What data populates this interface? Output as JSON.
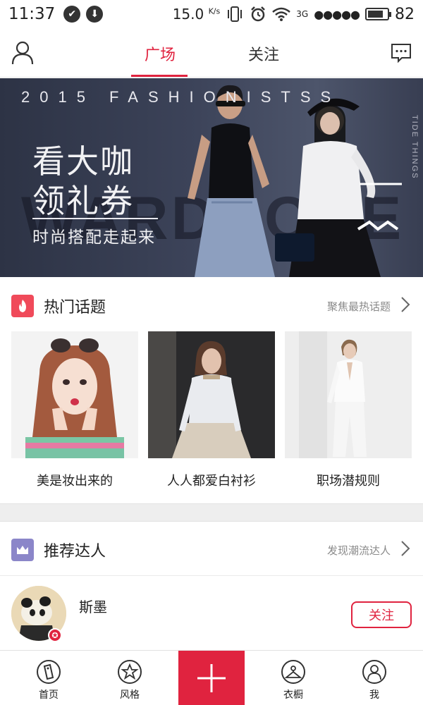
{
  "status_bar": {
    "time": "11:37",
    "net_speed": "15.0",
    "net_unit": "K/s",
    "network": "3G",
    "battery": "82",
    "battery_level": 0.82
  },
  "top_nav": {
    "tabs": [
      {
        "label": "广场",
        "active": true
      },
      {
        "label": "关注",
        "active": false
      }
    ]
  },
  "banner": {
    "header": "2015 FASHIONISTSS",
    "bg_word": "WARDROBE",
    "side_text": "TIDE THINGS",
    "line1": "看大咖",
    "line2": "领礼券",
    "subtitle": "时尚搭配走起来"
  },
  "hot_topics": {
    "title": "热门话题",
    "more": "聚焦最热话题",
    "items": [
      {
        "caption": "美是妆出来的"
      },
      {
        "caption": "人人都爱白衬衫"
      },
      {
        "caption": "职场潜规则"
      }
    ]
  },
  "experts": {
    "title": "推荐达人",
    "more": "发现潮流达人",
    "items": [
      {
        "name": "斯墨",
        "follow": "关注"
      }
    ]
  },
  "bottom_nav": {
    "items": [
      {
        "label": "首页"
      },
      {
        "label": "风格"
      },
      {
        "label": "衣橱"
      },
      {
        "label": "我"
      }
    ]
  },
  "colors": {
    "accent": "#e0233f",
    "hot_icon_bg": "#f04a5a",
    "expert_icon_bg": "#8b86c9"
  }
}
